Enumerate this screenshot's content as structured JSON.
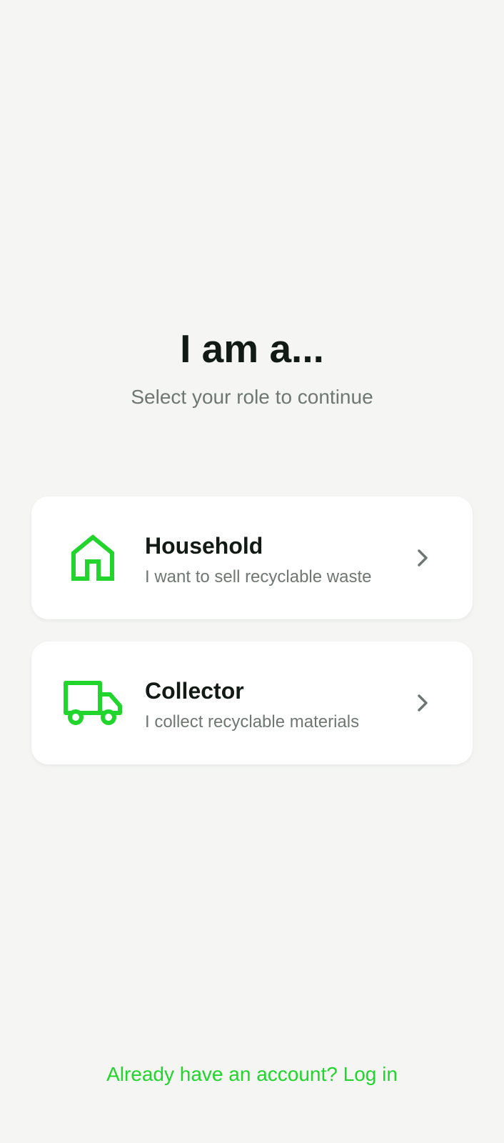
{
  "header": {
    "title": "I am a...",
    "subtitle": "Select your role to continue"
  },
  "roles": [
    {
      "title": "Household",
      "description": "I want to sell recyclable waste",
      "icon": "house-icon"
    },
    {
      "title": "Collector",
      "description": "I collect recyclable materials",
      "icon": "truck-icon"
    }
  ],
  "footer": {
    "login_text": "Already have an account? Log in"
  },
  "colors": {
    "accent": "#22d52c",
    "title_text": "#111a15",
    "secondary_text": "#6f7772",
    "background": "#f5f6f4",
    "card": "#ffffff"
  }
}
